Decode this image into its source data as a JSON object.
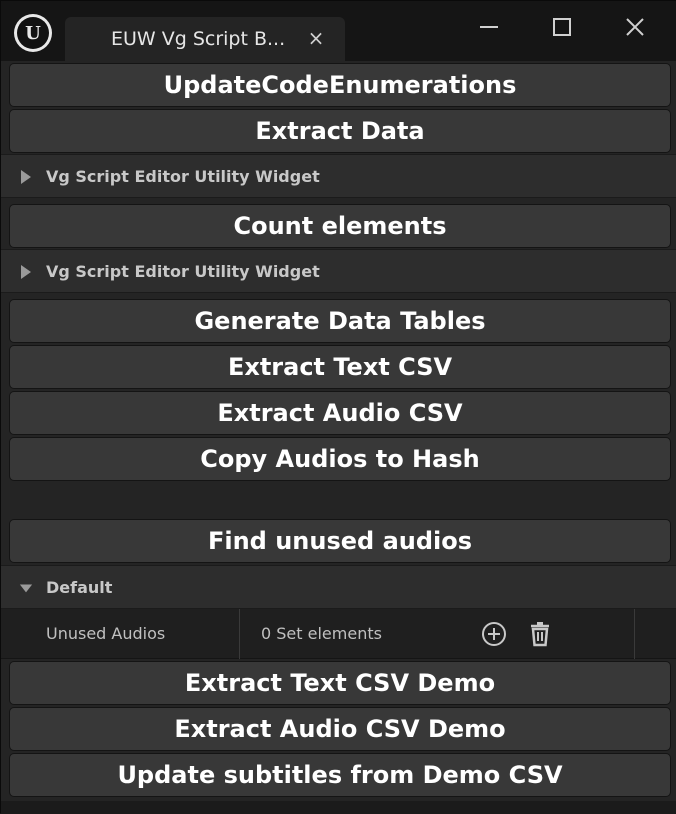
{
  "window": {
    "tab_title": "EUW Vg Script B...",
    "tab_close": "×"
  },
  "buttons": {
    "update_code_enumerations": "UpdateCodeEnumerations",
    "extract_data": "Extract Data",
    "count_elements": "Count elements",
    "generate_data_tables": "Generate Data Tables",
    "extract_text_csv": "Extract Text CSV",
    "extract_audio_csv": "Extract Audio CSV",
    "copy_audios_to_hash": "Copy Audios to Hash",
    "find_unused_audios": "Find unused audios",
    "extract_text_csv_demo": "Extract Text CSV Demo",
    "extract_audio_csv_demo": "Extract Audio CSV Demo",
    "update_subtitles_from_demo_csv": "Update subtitles from Demo CSV"
  },
  "sections": {
    "widget_1": "Vg Script Editor Utility Widget",
    "widget_2": "Vg Script Editor Utility Widget",
    "default": "Default"
  },
  "property": {
    "name": "Unused Audios",
    "value": "0 Set elements"
  },
  "icons": {
    "logo": "unreal-logo",
    "minimize": "minimize-icon",
    "maximize": "maximize-icon",
    "close": "close-icon",
    "collapsed": "caret-right-icon",
    "expanded": "caret-down-icon",
    "add": "add-circle-icon",
    "delete": "trash-icon"
  },
  "colors": {
    "button_bg": "#383838",
    "panel_bg": "#242424",
    "section_bg": "#2d2d2d",
    "title_bg": "#151515"
  }
}
